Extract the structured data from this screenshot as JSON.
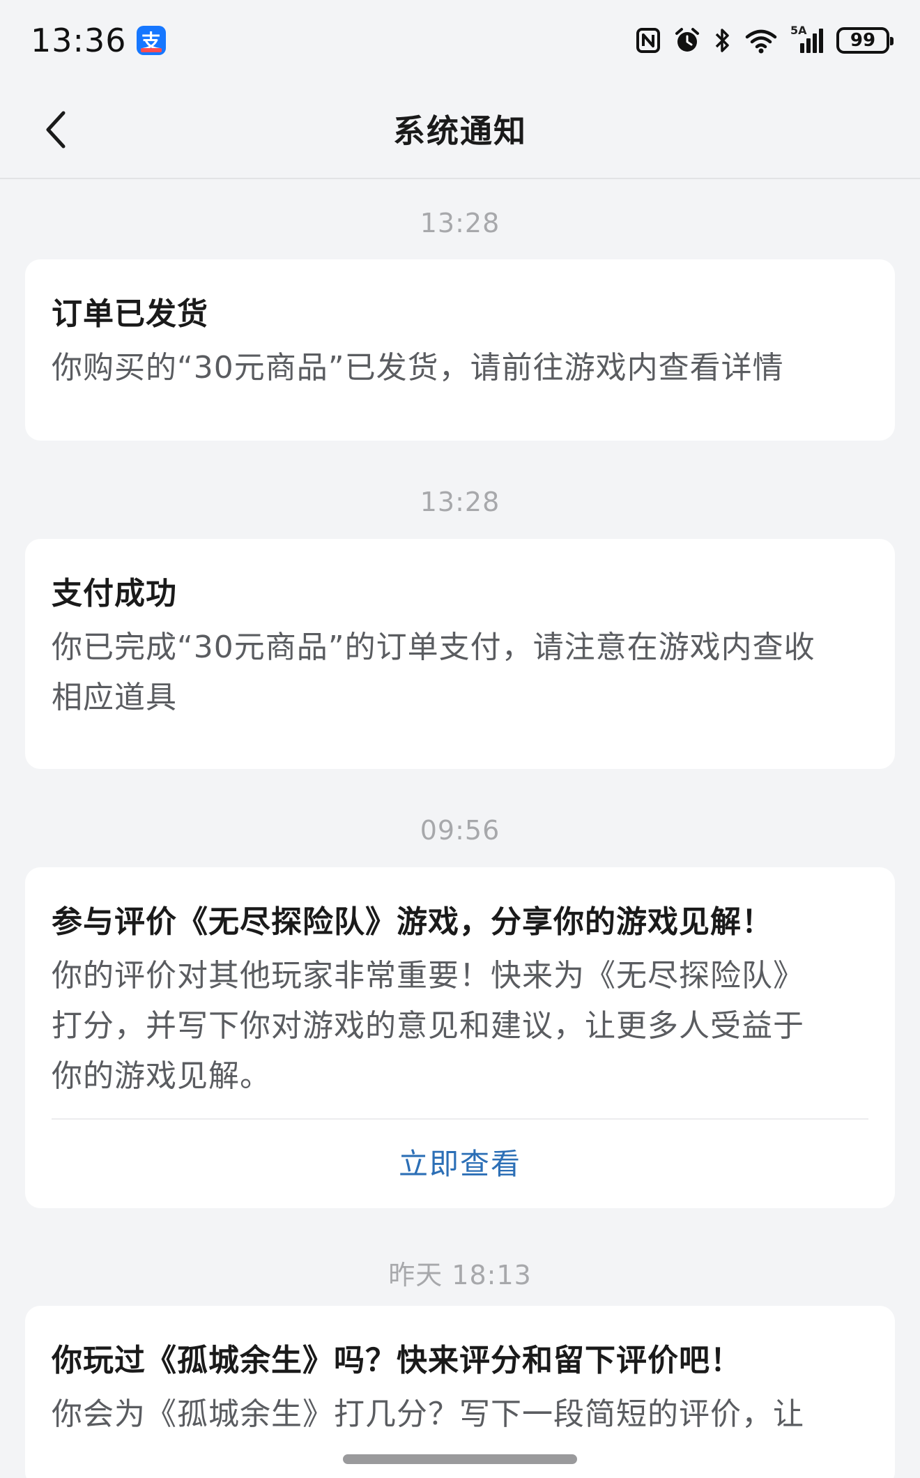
{
  "status_bar": {
    "time": "13:36",
    "app_icon": "alipay-icon",
    "app_icon_char": "支",
    "network_label": "5A",
    "battery_level": "99"
  },
  "header": {
    "title": "系统通知",
    "back_icon": "chevron-left-icon"
  },
  "notifications": [
    {
      "timestamp": "13:28",
      "title": "订单已发货",
      "body_lines": [
        "你购买的“30元商品”已发货，请前往游戏内查看详情"
      ]
    },
    {
      "timestamp": "13:28",
      "title": "支付成功",
      "body_lines": [
        "你已完成“30元商品”的订单支付，请注意在游戏内查收",
        "相应道具"
      ]
    },
    {
      "timestamp": "09:56",
      "title": "参与评价《无尽探险队》游戏，分享你的游戏见解！",
      "body_lines": [
        "你的评价对其他玩家非常重要！快来为《无尽探险队》",
        "打分，并写下你对游戏的意见和建议，让更多人受益于",
        "你的游戏见解。"
      ],
      "action_label": "立即查看"
    },
    {
      "timestamp": "昨天   18:13",
      "title": "你玩过《孤城余生》吗？快来评分和留下评价吧！",
      "body_lines": [
        "你会为《孤城余生》打几分？写下一段简短的评价，让"
      ]
    }
  ]
}
